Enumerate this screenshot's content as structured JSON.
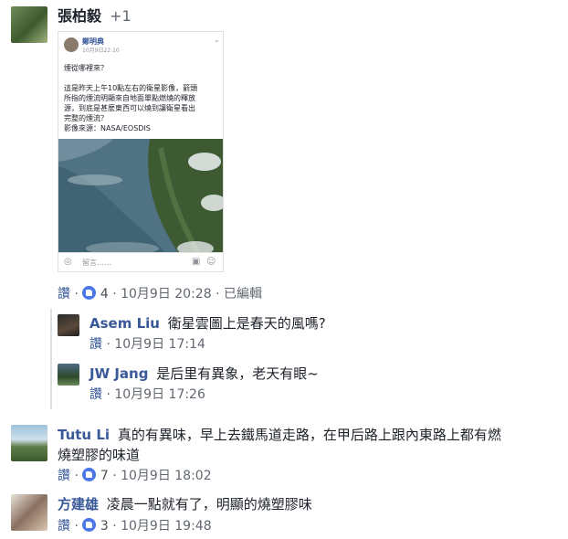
{
  "top": {
    "author": "張柏毅",
    "extra": "+1"
  },
  "shared_post": {
    "author": "鄭明典",
    "time": "10月9日22:10 · ",
    "text_lines": [
      "煙從哪裡來？",
      "",
      "這是昨天上午10點左右的衛星影像，箭頭",
      "所指的煙流明顯來自地面單點燃燒的釋放",
      "源，到底是甚麼東西可以燒到讓衛星看出",
      "完整的煙流？",
      "影像來源：NASA/EOSDIS"
    ],
    "comment_placeholder": "留言……"
  },
  "first_meta": {
    "like_label": "讚",
    "reactions": "4",
    "date": "10月9日 20:28",
    "edited": "已編輯"
  },
  "replies": [
    {
      "author": "Asem Liu",
      "text": "衛星雲圖上是春天的風嗎?",
      "like_label": "讚",
      "date": "10月9日 17:14"
    },
    {
      "author": "JW Jang",
      "text": "是后里有異象，老天有眼~",
      "like_label": "讚",
      "date": "10月9日 17:26"
    }
  ],
  "comments": [
    {
      "author": "Tutu Li",
      "text_line1": "真的有異味，早上去鐵馬道走路，在甲后路上跟內東路上都有燃",
      "text_line2": "燒塑膠的味道",
      "like_label": "讚",
      "reactions": "7",
      "date": "10月9日 18:02"
    },
    {
      "author": "方建雄",
      "text": "凌晨一點就有了，明顯的燒塑膠味",
      "like_label": "讚",
      "reactions": "3",
      "date": "10月9日 19:48"
    }
  ],
  "colors": {
    "link_blue": "#385898",
    "like_blue": "#4a76e8",
    "meta_gray": "#616770"
  }
}
